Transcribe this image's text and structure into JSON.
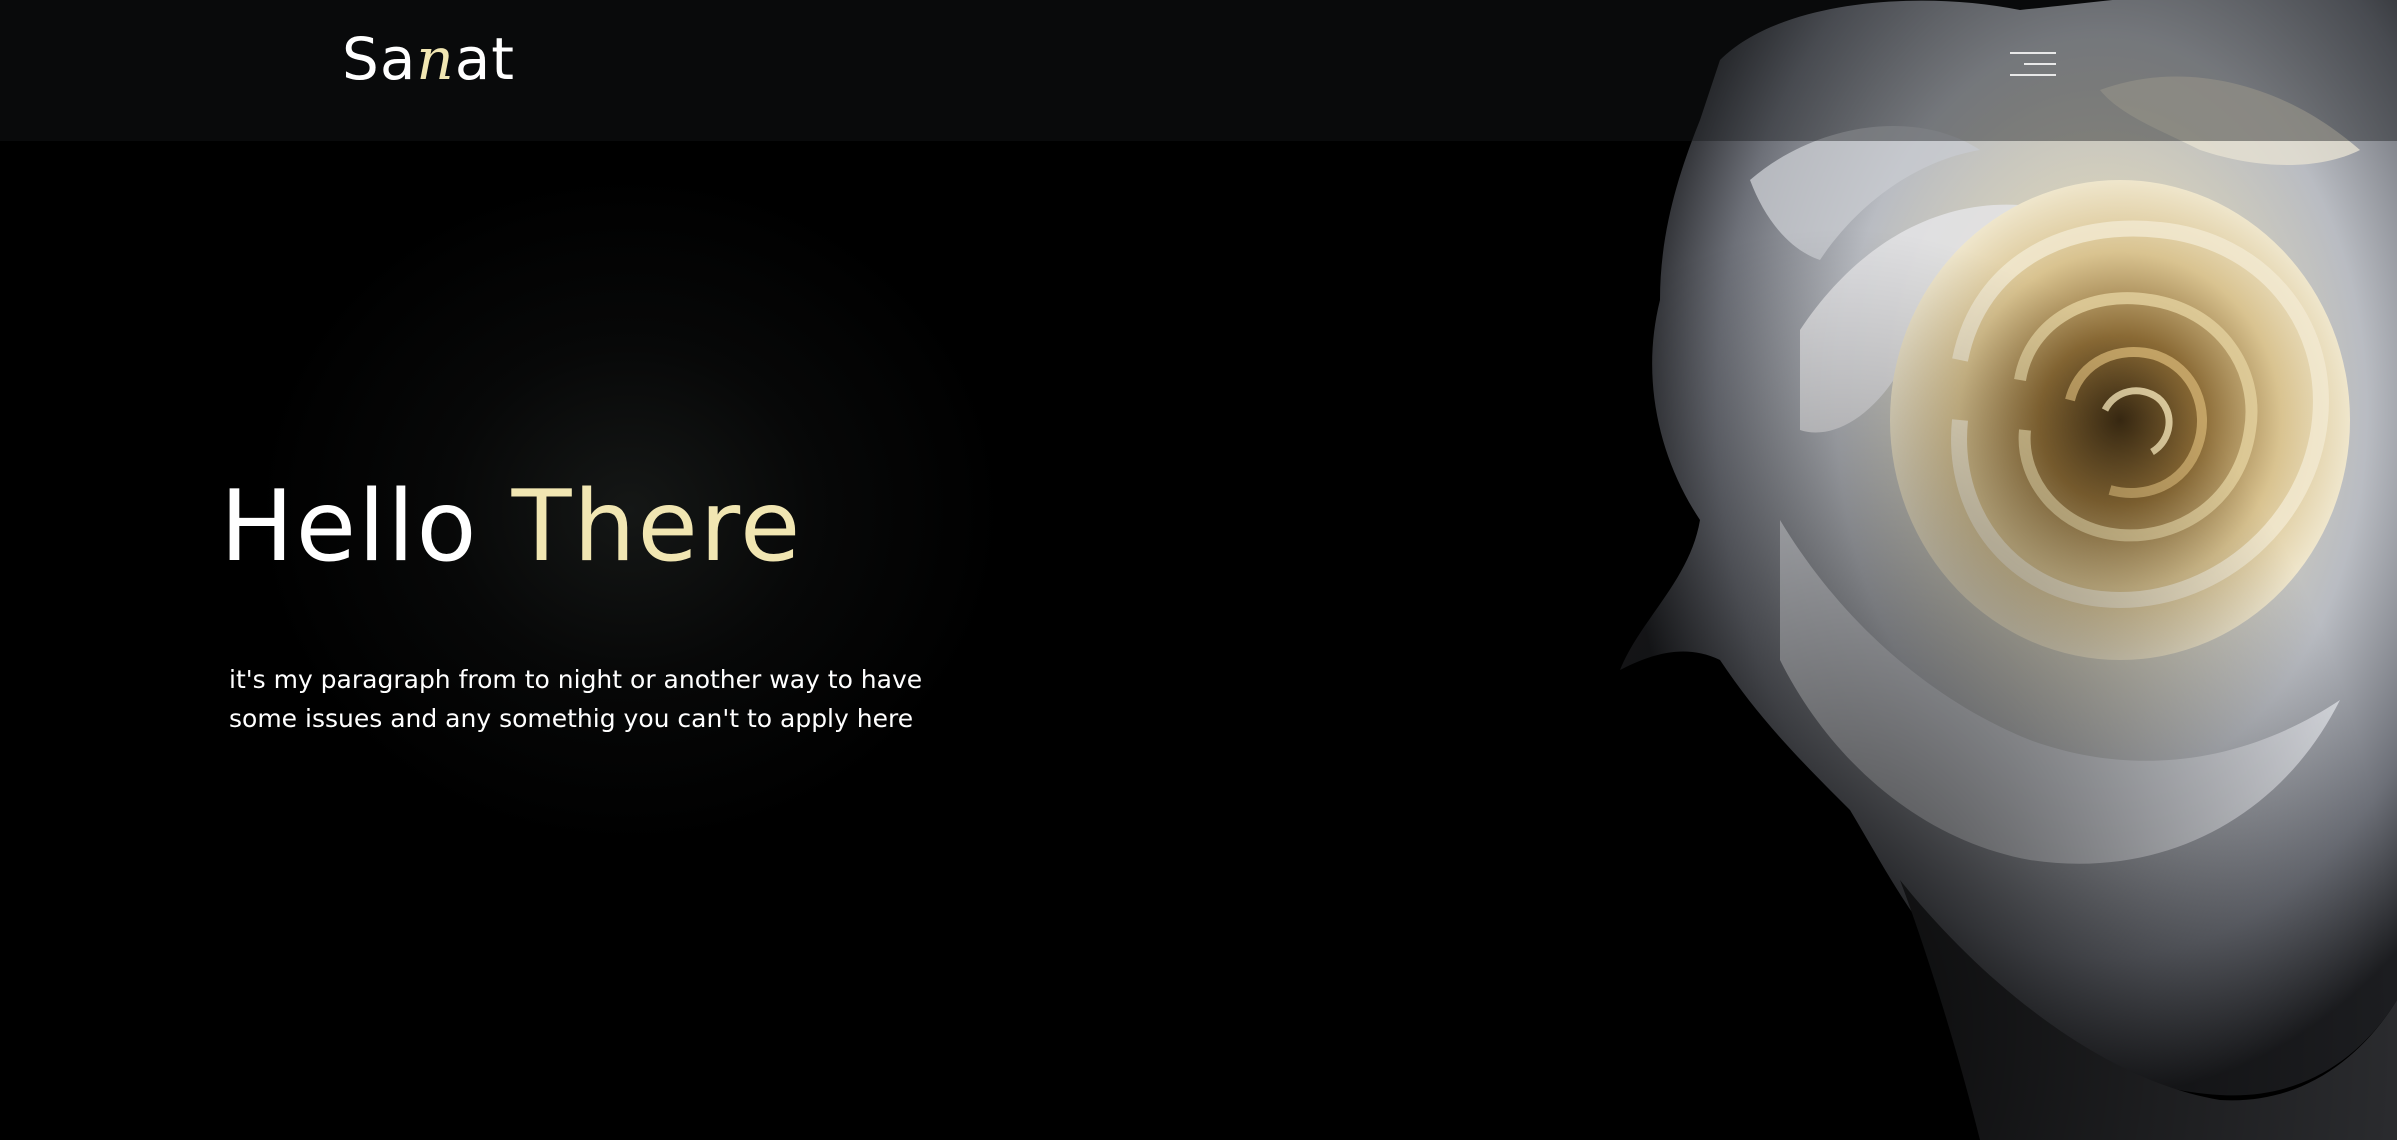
{
  "header": {
    "logo": {
      "part1": "Sa",
      "accent": "n",
      "part2": "at"
    },
    "menu_icon": "hamburger-menu-icon"
  },
  "hero": {
    "title_main": "Hello",
    "title_accent": "There",
    "paragraph": "it's my paragraph from to night or another way to have some issues and any somethig you can't to apply here"
  },
  "image": {
    "subject": "rose-image"
  },
  "colors": {
    "background": "#000000",
    "accent": "#f1e6b2",
    "text": "#ffffff",
    "header_bg": "#16181a"
  }
}
